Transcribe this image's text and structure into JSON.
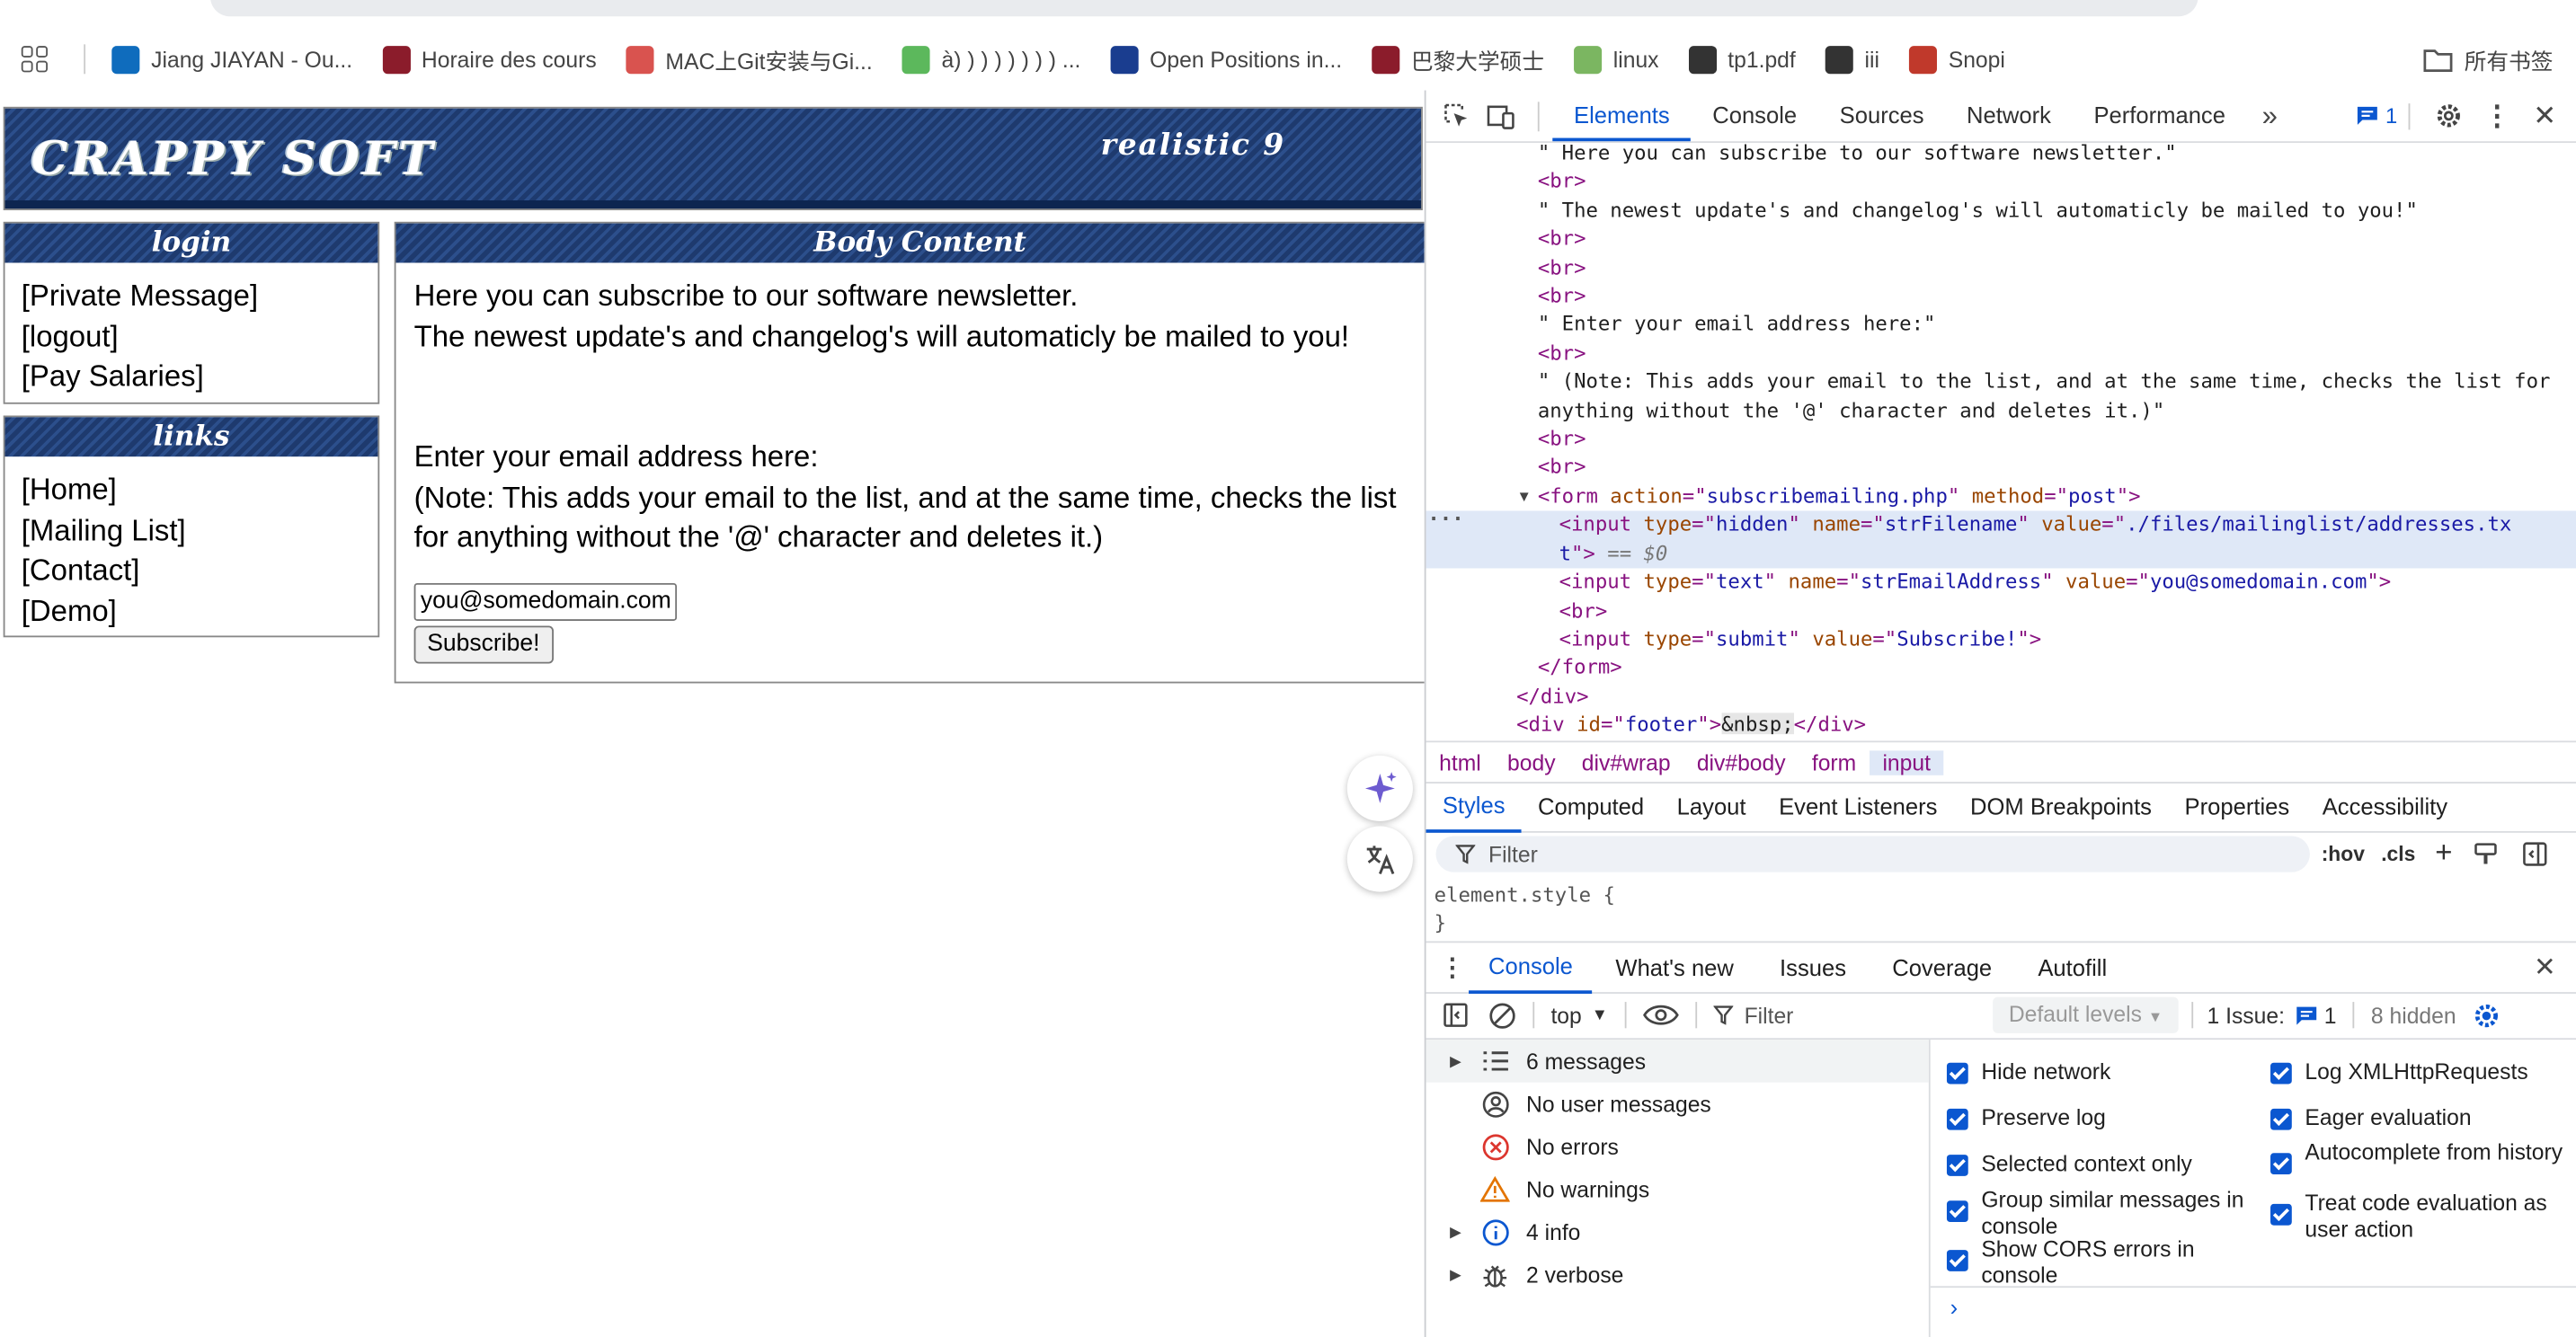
{
  "bookmarks": [
    {
      "label": "Jiang JIAYAN - Ou...",
      "icon": "outlook-icon",
      "color": "#0f6cbd"
    },
    {
      "label": "Horaire des cours",
      "icon": "university-icon",
      "color": "#8b1c2b"
    },
    {
      "label": "MAC上Git安装与Gi...",
      "icon": "jian-icon",
      "color": "#d9534f"
    },
    {
      "label": "à) ) ) ) ) ) ) ) ...",
      "icon": "paw-icon",
      "color": "#5cb85c"
    },
    {
      "label": "Open Positions in...",
      "icon": "globe-icon",
      "color": "#1a3d8f"
    },
    {
      "label": "巴黎大学硕士",
      "icon": "university-icon",
      "color": "#8b1c2b"
    },
    {
      "label": "linux",
      "icon": "linux-icon",
      "color": "#7bb661"
    },
    {
      "label": "tp1.pdf",
      "icon": "world-icon",
      "color": "#333333"
    },
    {
      "label": "iii",
      "icon": "openai-icon",
      "color": "#333333"
    },
    {
      "label": "Snopi",
      "icon": "snopi-icon",
      "color": "#c0392b"
    }
  ],
  "bookmarks_folder": "所有书签",
  "site": {
    "banner_title": "CRAPPY SOFT",
    "banner_subtitle": "realistic 9",
    "login_head": "login",
    "login_links": [
      "[Private Message]",
      "[logout]",
      "[Pay Salaries]"
    ],
    "links_head": "links",
    "nav_links": [
      "[Home]",
      "[Mailing List]",
      "[Contact]",
      "[Demo]"
    ],
    "body_head": "Body Content",
    "body_line1": "Here you can subscribe to our software newsletter.",
    "body_line2": "The newest update's and changelog's will automaticly be mailed to you!",
    "body_line3": "Enter your email address here:",
    "body_line4": "(Note: This adds your email to the list, and at the same time, checks the list",
    "body_line5": "for anything without the '@' character and deletes it.)",
    "email_value": "you@somedomain.com",
    "subscribe_label": "Subscribe!"
  },
  "devtools": {
    "tabs": [
      "Elements",
      "Console",
      "Sources",
      "Network",
      "Performance"
    ],
    "issues_badge": "1",
    "tree": [
      "\" Here you can subscribe to our software newsletter.\"",
      "<br>",
      "\" The newest update's and changelog's will automaticly be mailed to you!\"",
      "<br>",
      "<br>",
      "<br>",
      "\" Enter your email address here:\"",
      "<br>",
      "\" (Note: This adds your email to the list, and at the same time, checks the list for",
      "anything without the '@' character and deletes it.)\"",
      "<br>",
      "<br>"
    ],
    "form_action": "subscribemailing.php",
    "form_method": "post",
    "hidden_name": "strFilename",
    "hidden_value_1": "./files/mailinglist/addresses.tx",
    "hidden_value_2": "t",
    "dollar_zero": "== $0",
    "text_name": "strEmailAddress",
    "text_value": "you@somedomain.com",
    "submit_value": "Subscribe!",
    "footer_id": "footer",
    "footer_content": "&nbsp;",
    "breadcrumbs": [
      "html",
      "body",
      "div#wrap",
      "div#body",
      "form",
      "input"
    ],
    "sub_tabs": [
      "Styles",
      "Computed",
      "Layout",
      "Event Listeners",
      "DOM Breakpoints",
      "Properties",
      "Accessibility"
    ],
    "filter_placeholder": "Filter",
    "hov": ":hov",
    "cls": ".cls",
    "element_style_1": "element.style {",
    "element_style_2": "}",
    "drawer_tabs": [
      "Console",
      "What's new",
      "Issues",
      "Coverage",
      "Autofill"
    ],
    "context": "top",
    "console_filter": "Filter",
    "levels": "Default levels",
    "issues_text": "1 Issue:",
    "issues_count": "1",
    "hidden_text": "8 hidden",
    "messages": [
      {
        "label": "6 messages",
        "icon": "list-icon",
        "expand": true
      },
      {
        "label": "No user messages",
        "icon": "user-icon",
        "expand": false
      },
      {
        "label": "No errors",
        "icon": "error-icon",
        "expand": false
      },
      {
        "label": "No warnings",
        "icon": "warning-icon",
        "expand": false
      },
      {
        "label": "4 info",
        "icon": "info-icon",
        "expand": true
      },
      {
        "label": "2 verbose",
        "icon": "bug-icon",
        "expand": true
      }
    ],
    "settings_left": [
      "Hide network",
      "Preserve log",
      "Selected context only",
      "Group similar messages in console",
      "Show CORS errors in console"
    ],
    "settings_right": [
      "Log XMLHttpRequests",
      "Eager evaluation",
      "Autocomplete from history",
      "Treat code evaluation as user action"
    ]
  }
}
